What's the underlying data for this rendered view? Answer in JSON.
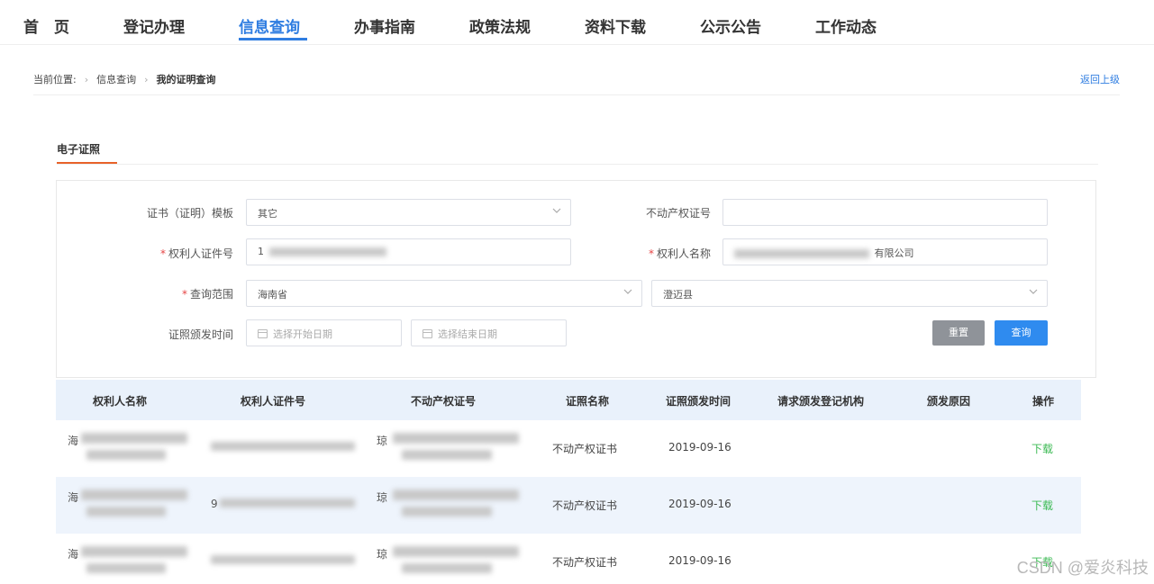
{
  "nav": {
    "items": [
      {
        "label": "首　页"
      },
      {
        "label": "登记办理"
      },
      {
        "label": "信息查询"
      },
      {
        "label": "办事指南"
      },
      {
        "label": "政策法规"
      },
      {
        "label": "资料下载"
      },
      {
        "label": "公示公告"
      },
      {
        "label": "工作动态"
      }
    ],
    "active": "信息查询"
  },
  "breadcrumb": {
    "prefix": "当前位置:",
    "items": [
      "信息查询",
      "我的证明查询"
    ],
    "back": "返回上级"
  },
  "tab": {
    "label": "电子证照"
  },
  "form": {
    "template_label": "证书（证明）模板",
    "template_value": "其它",
    "cert_no_label": "不动产权证号",
    "cert_no_value": "",
    "holder_id_label": "权利人证件号",
    "holder_id_visible": "1",
    "holder_name_label": "权利人名称",
    "holder_name_visible": "有限公司",
    "scope_label": "查询范围",
    "scope_province": "海南省",
    "scope_county": "澄迈县",
    "date_label": "证照颁发时间",
    "date_start_placeholder": "选择开始日期",
    "date_end_placeholder": "选择结束日期",
    "reset": "重置",
    "search": "查询"
  },
  "table": {
    "headers": [
      "权利人名称",
      "权利人证件号",
      "不动产权证号",
      "证照名称",
      "证照颁发时间",
      "请求颁发登记机构",
      "颁发原因",
      "操作"
    ],
    "rows": [
      {
        "name_prefix": "海",
        "id_prefix": "",
        "cert_prefix": "琼",
        "license": "不动产权证书",
        "date": "2019-09-16",
        "action": "下载"
      },
      {
        "name_prefix": "海",
        "id_prefix": "9",
        "cert_prefix": "琼",
        "license": "不动产权证书",
        "date": "2019-09-16",
        "action": "下载"
      },
      {
        "name_prefix": "海",
        "id_prefix": "",
        "cert_prefix": "琼",
        "license": "不动产权证书",
        "date": "2019-09-16",
        "action": "下载"
      }
    ]
  },
  "watermark": "CSDN @爱炎科技",
  "colors": {
    "accent": "#2f7de1",
    "tab_accent": "#e8622a",
    "download": "#3cba54",
    "header_bg": "#e9f1fb"
  }
}
